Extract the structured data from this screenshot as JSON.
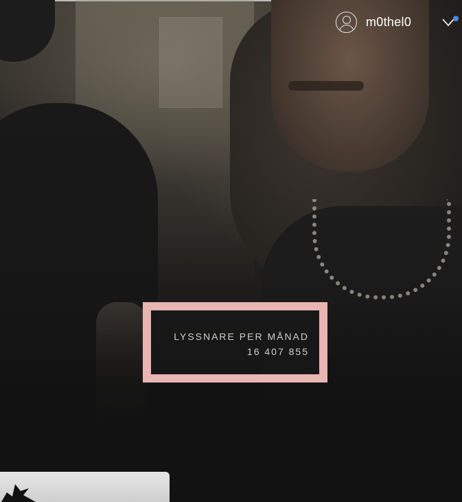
{
  "header": {
    "username": "m0thel0",
    "avatar_icon": "user-icon",
    "menu_icon": "chevron-down-icon",
    "notification_color": "#4a86e8"
  },
  "artist": {
    "monthly_listeners_label": "LYSSNARE PER MÅNAD",
    "monthly_listeners_value": "16 407 855",
    "highlight_color": "#e8b5b3"
  }
}
